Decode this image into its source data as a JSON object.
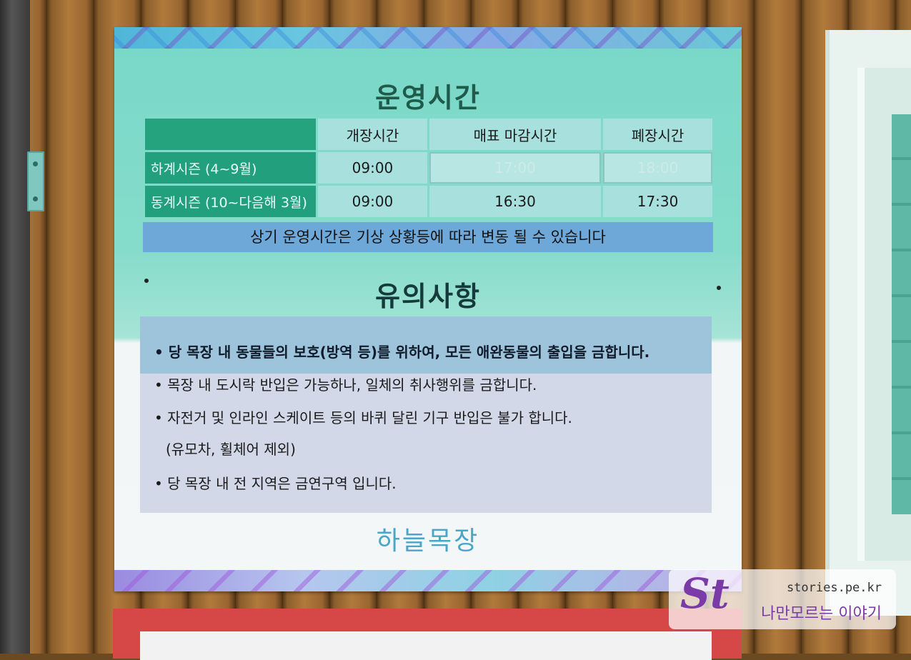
{
  "hours": {
    "title": "운영시간",
    "columns": [
      "개장시간",
      "매표 마감시간",
      "폐장시간"
    ],
    "rows": [
      {
        "season": "하계시즌 (4~9월)",
        "open": "09:00",
        "ticket_close": "17:00",
        "close": "18:00"
      },
      {
        "season": "동계시즌 (10~다음해 3월)",
        "open": "09:00",
        "ticket_close": "16:30",
        "close": "17:30"
      }
    ],
    "notice": "상기 운영시간은 기상 상황등에 따라 변동 될 수 있습니다"
  },
  "caution": {
    "title": "유의사항",
    "items": [
      "• 당 목장 내 동물들의 보호(방역 등)를 위하여, 모든 애완동물의 출입을 금합니다.",
      "• 목장 내 도시락 반입은 가능하나, 일체의 취사행위를 금합니다.",
      "• 자전거 및 인라인 스케이트 등의 바퀴 달린 기구 반입은 불가 합니다.",
      "(유모차, 휠체어 제외)",
      "• 당 목장 내 전 지역은 금연구역 입니다."
    ]
  },
  "sign_logo": "하늘목장",
  "watermark": {
    "logo": "St",
    "url": "stories.pe.kr",
    "text": "나만모르는 이야기"
  },
  "colors": {
    "sign_top": "#78d8c8",
    "season_cell": "#22a07e",
    "notice_bar": "#6ea8d8",
    "red_sign": "#d64848",
    "watermark_accent": "#7a3aa8"
  }
}
